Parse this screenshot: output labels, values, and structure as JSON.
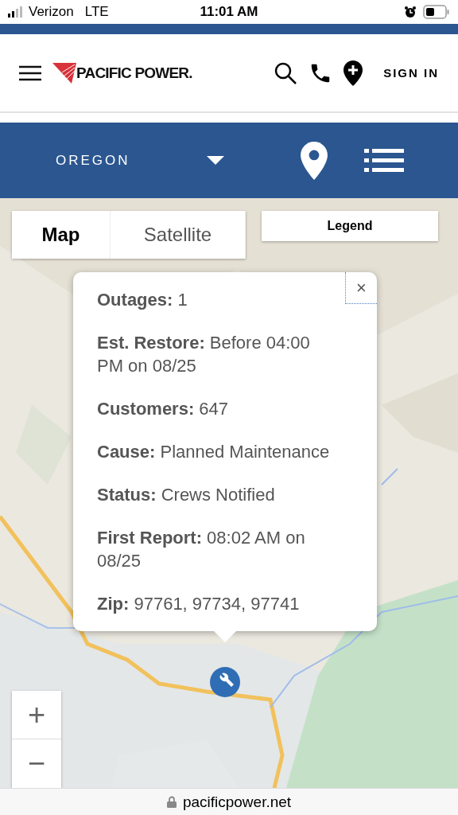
{
  "status_bar": {
    "carrier": "Verizon",
    "network": "LTE",
    "time": "11:01 AM"
  },
  "header": {
    "logo": "PACIFIC POWER.",
    "sign_in": "SIGN IN"
  },
  "region_bar": {
    "state": "OREGON"
  },
  "map": {
    "tabs": [
      {
        "label": "Map",
        "selected": true
      },
      {
        "label": "Satellite",
        "selected": false
      }
    ],
    "legend": "Legend",
    "popup": {
      "close": "×",
      "fields": [
        {
          "label": "Outages:",
          "value": "1"
        },
        {
          "label": "Est. Restore:",
          "value": "Before 04:00 PM on 08/25"
        },
        {
          "label": "Customers:",
          "value": "647"
        },
        {
          "label": "Cause:",
          "value": "Planned Maintenance"
        },
        {
          "label": "Status:",
          "value": "Crews Notified"
        },
        {
          "label": "First Report:",
          "value": "08:02 AM on 08/25"
        },
        {
          "label": "Zip:",
          "value": "97761, 97734, 97741"
        }
      ]
    },
    "zoom": {
      "in": "+",
      "out": "−"
    }
  },
  "url_bar": {
    "url": "pacificpower.net"
  }
}
